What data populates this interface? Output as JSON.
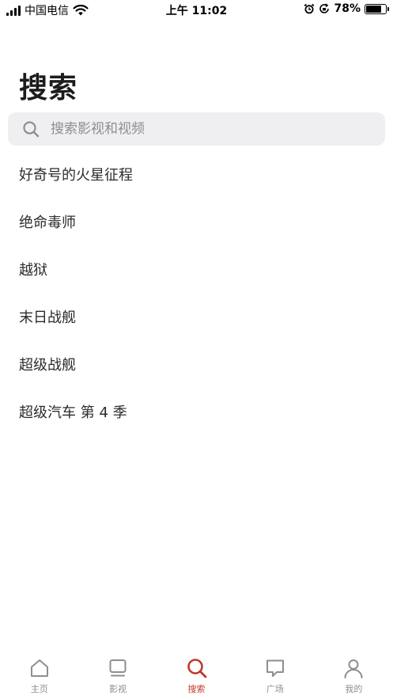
{
  "status_bar": {
    "carrier": "中国电信",
    "time": "上午 11:02",
    "battery": "78%",
    "battery_level": 0.78
  },
  "page": {
    "title": "搜索"
  },
  "search": {
    "placeholder": "搜索影视和视频",
    "value": ""
  },
  "suggestions": [
    "好奇号的火星征程",
    "绝命毒师",
    "越狱",
    "末日战舰",
    "超级战舰",
    "超级汽车 第 4 季"
  ],
  "tabs": [
    {
      "label": "主页",
      "icon": "home-icon",
      "active": false
    },
    {
      "label": "影视",
      "icon": "tv-icon",
      "active": false
    },
    {
      "label": "搜索",
      "icon": "search-icon",
      "active": true
    },
    {
      "label": "广场",
      "icon": "chat-bubble-icon",
      "active": false
    },
    {
      "label": "我的",
      "icon": "person-icon",
      "active": false
    }
  ],
  "colors": {
    "accent": "#c0392b",
    "inactive": "#8e8e93",
    "search_bg": "#efeff1"
  }
}
